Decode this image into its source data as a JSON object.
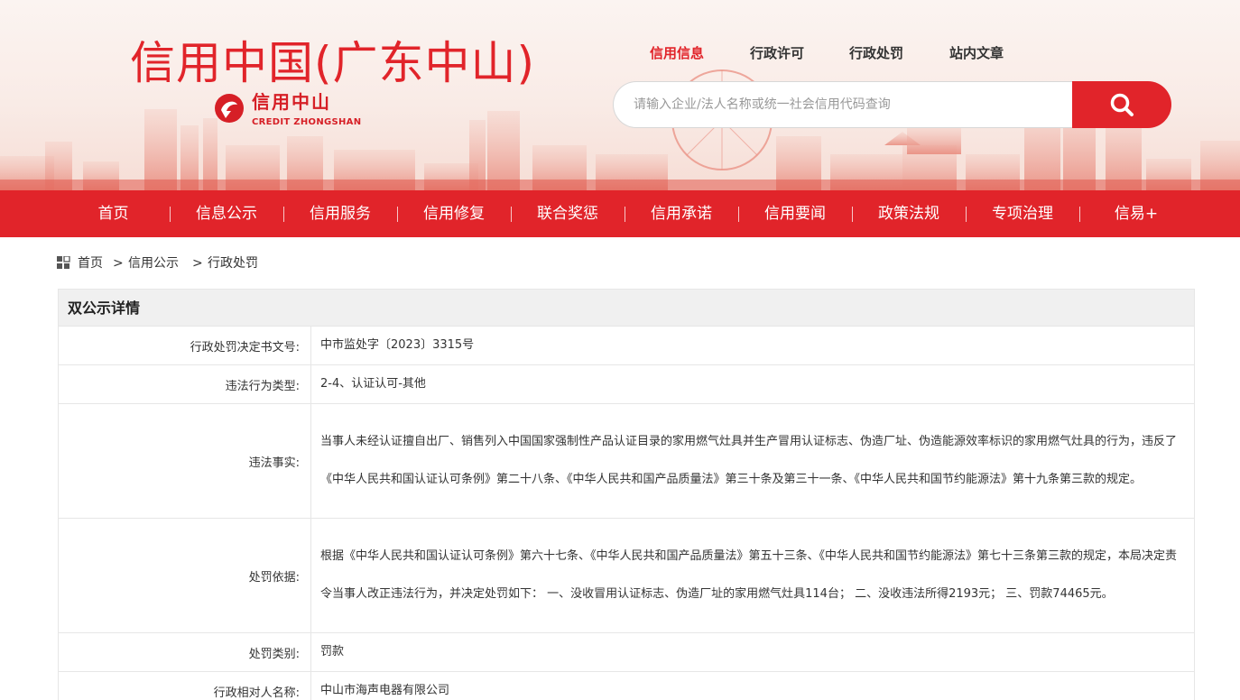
{
  "header": {
    "site_title": "信用中国(广东中山)",
    "logo_cn": "信用中山",
    "logo_en": "CREDIT ZHONGSHAN",
    "top_nav": [
      {
        "label": "信用信息",
        "active": true
      },
      {
        "label": "行政许可",
        "active": false
      },
      {
        "label": "行政处罚",
        "active": false
      },
      {
        "label": "站内文章",
        "active": false
      }
    ],
    "search": {
      "placeholder": "请输入企业/法人名称或统一社会信用代码查询"
    }
  },
  "main_nav": [
    "首页",
    "信息公示",
    "信用服务",
    "信用修复",
    "联合奖惩",
    "信用承诺",
    "信用要闻",
    "政策法规",
    "专项治理",
    "信易+"
  ],
  "breadcrumb": {
    "items": [
      "首页",
      "信用公示"
    ],
    "separator": ">",
    "current": "行政处罚"
  },
  "detail": {
    "title": "双公示详情",
    "rows": [
      {
        "label": "行政处罚决定书文号:",
        "value": "中市监处字〔2023〕3315号"
      },
      {
        "label": "违法行为类型:",
        "value": "2-4、认证认可-其他"
      },
      {
        "label": "违法事实:",
        "value": "当事人未经认证擅自出厂、销售列入中国国家强制性产品认证目录的家用燃气灶具并生产冒用认证标志、伪造厂址、伪造能源效率标识的家用燃气灶具的行为，违反了《中华人民共和国认证认可条例》第二十八条、《中华人民共和国产品质量法》第三十条及第三十一条、《中华人民共和国节约能源法》第十九条第三款的规定。"
      },
      {
        "label": "处罚依据:",
        "value": "根据《中华人民共和国认证认可条例》第六十七条、《中华人民共和国产品质量法》第五十三条、《中华人民共和国节约能源法》第七十三条第三款的规定，本局决定责令当事人改正违法行为，并决定处罚如下： 一、没收冒用认证标志、伪造厂址的家用燃气灶具114台； 二、没收违法所得2193元； 三、罚款74465元。"
      },
      {
        "label": "处罚类别:",
        "value": "罚款"
      },
      {
        "label": "行政相对人名称:",
        "value": "中山市海声电器有限公司"
      }
    ]
  },
  "colors": {
    "brand_red": "#e1242a",
    "header_bg": "#f9ebe6",
    "table_head_bg": "#f0f0f0",
    "border": "#e6e6e6"
  },
  "icons": {
    "search": "search-icon",
    "breadcrumb": "grid-icon",
    "logo": "credit-logo-icon"
  }
}
